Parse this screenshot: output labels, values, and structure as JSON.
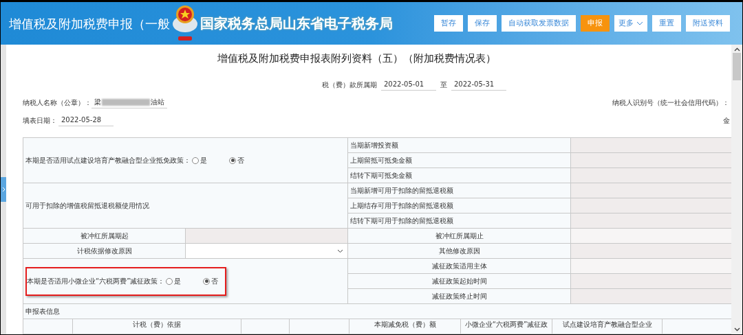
{
  "header": {
    "title": "增值税及附加税费申报（一般",
    "banner": "国家税务总局山东省电子税务局",
    "buttons": [
      {
        "label": "暂存",
        "kind": "plain"
      },
      {
        "label": "保存",
        "kind": "plain"
      },
      {
        "label": "自动获取发票数据",
        "kind": "plain"
      },
      {
        "label": "申报",
        "kind": "primary"
      },
      {
        "label": "更多",
        "kind": "dropdown"
      },
      {
        "label": "重置",
        "kind": "plain"
      },
      {
        "label": "附送资料",
        "kind": "plain"
      }
    ]
  },
  "form_title": "增值税及附加税费申报表附列资料（五）（附加税费情况表）",
  "period": {
    "label": "税（费）款所属期",
    "from": "2022-05-01",
    "separator": "至",
    "to": "2022-05-31"
  },
  "taxpayer_name": {
    "label": "纳税人名称（公章）：",
    "value_start": "梁",
    "value_end": "油站"
  },
  "taxpayer_id_label": "纳税人识别号（统一社会信用代码）：",
  "fill_date": {
    "label": "填表日期：",
    "value": "2022-05-28"
  },
  "amount_unit": "金",
  "table": {
    "policy": {
      "question": "本期是否适用试点建设培育产教融合型企业抵免政策：",
      "highlighted": false,
      "options": [
        {
          "label": "是",
          "selected": false
        },
        {
          "label": "否",
          "selected": true
        }
      ],
      "fields": [
        {
          "label": "当期新增投资额",
          "kind": "disabled"
        },
        {
          "label": "上期留抵可抵免金额",
          "kind": "disabled"
        },
        {
          "label": "结转下期可抵免金额",
          "kind": "disabled"
        }
      ]
    },
    "deduction": {
      "label": "可用于扣除的增值税留抵退税额使用情况",
      "fields": [
        {
          "label": "当期新增可用于扣除的留抵退税额",
          "kind": "disabled"
        },
        {
          "label": "上期结存可用于扣除的留抵退税额",
          "kind": "disabled"
        },
        {
          "label": "结转下期可用于扣除的留抵退税额",
          "kind": "disabled"
        }
      ]
    },
    "pairs": [
      [
        {
          "label": "被冲红所属期起",
          "kind": "disabled"
        },
        {
          "label": "被冲红所属期止",
          "kind": "input"
        }
      ],
      [
        {
          "label": "计税依据修改原因",
          "kind": "select"
        },
        {
          "label": "其他修改原因",
          "kind": "disabled"
        }
      ]
    ],
    "small_policy": {
      "question": "本期是否适用小微企业“六税两费”减征政策：",
      "highlighted": true,
      "options": [
        {
          "label": "是",
          "selected": false
        },
        {
          "label": "否",
          "selected": true
        }
      ],
      "fields": [
        {
          "label": "减征政策适用主体",
          "kind": "input"
        },
        {
          "label": "减征政策起始时间",
          "kind": "disabled"
        },
        {
          "label": "减征政策终止时间",
          "kind": "disabled"
        }
      ]
    },
    "info_label": "申报表信息",
    "columns": [
      "计税（费）依据",
      "本期减免税（费）额",
      "小微企业“六税两费”减征政",
      "试点建设培育产教融合型企业"
    ]
  }
}
